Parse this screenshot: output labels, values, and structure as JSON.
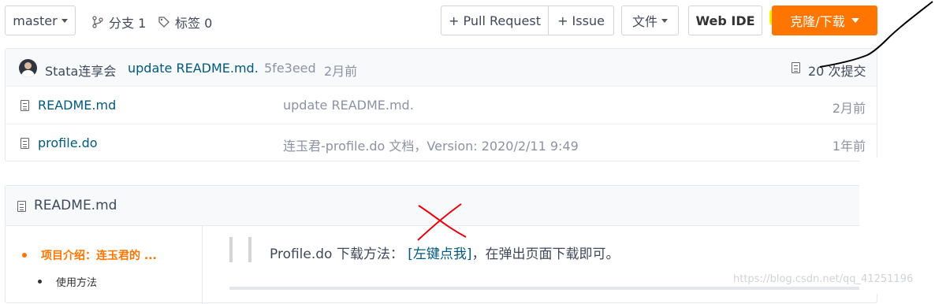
{
  "toolbar": {
    "branch": "master",
    "branches_label": "分支 1",
    "tags_label": "标签 0",
    "pull_request": "+ Pull Request",
    "issue": "+ Issue",
    "files": "文件",
    "web_ide": "Web IDE",
    "clone": "克隆/下载"
  },
  "commit": {
    "author": "Stata连享会",
    "message": "update README.md.",
    "hash": "5fe3eed",
    "time": "2月前",
    "count": "20 次提交"
  },
  "files": [
    {
      "name": "README.md",
      "message": "update README.md.",
      "time": "2月前"
    },
    {
      "name": "profile.do",
      "message": "连玉君-profile.do 文档，Version: 2020/2/11 9:49",
      "time": "1年前"
    }
  ],
  "readme": {
    "title": "README.md",
    "toc": [
      {
        "label": "项目介绍：连玉君的 ..."
      },
      {
        "label": "使用方法"
      }
    ],
    "quote_prefix": "Profile.do 下载方法：",
    "quote_link": "[左键点我]",
    "quote_suffix": "，在弹出页面下载即可。"
  },
  "watermark": "https://blog.csdn.net/qq_41251196",
  "colors": {
    "clone_bg": "#ff7500",
    "link": "#005980",
    "toc_active": "#ff7500"
  }
}
